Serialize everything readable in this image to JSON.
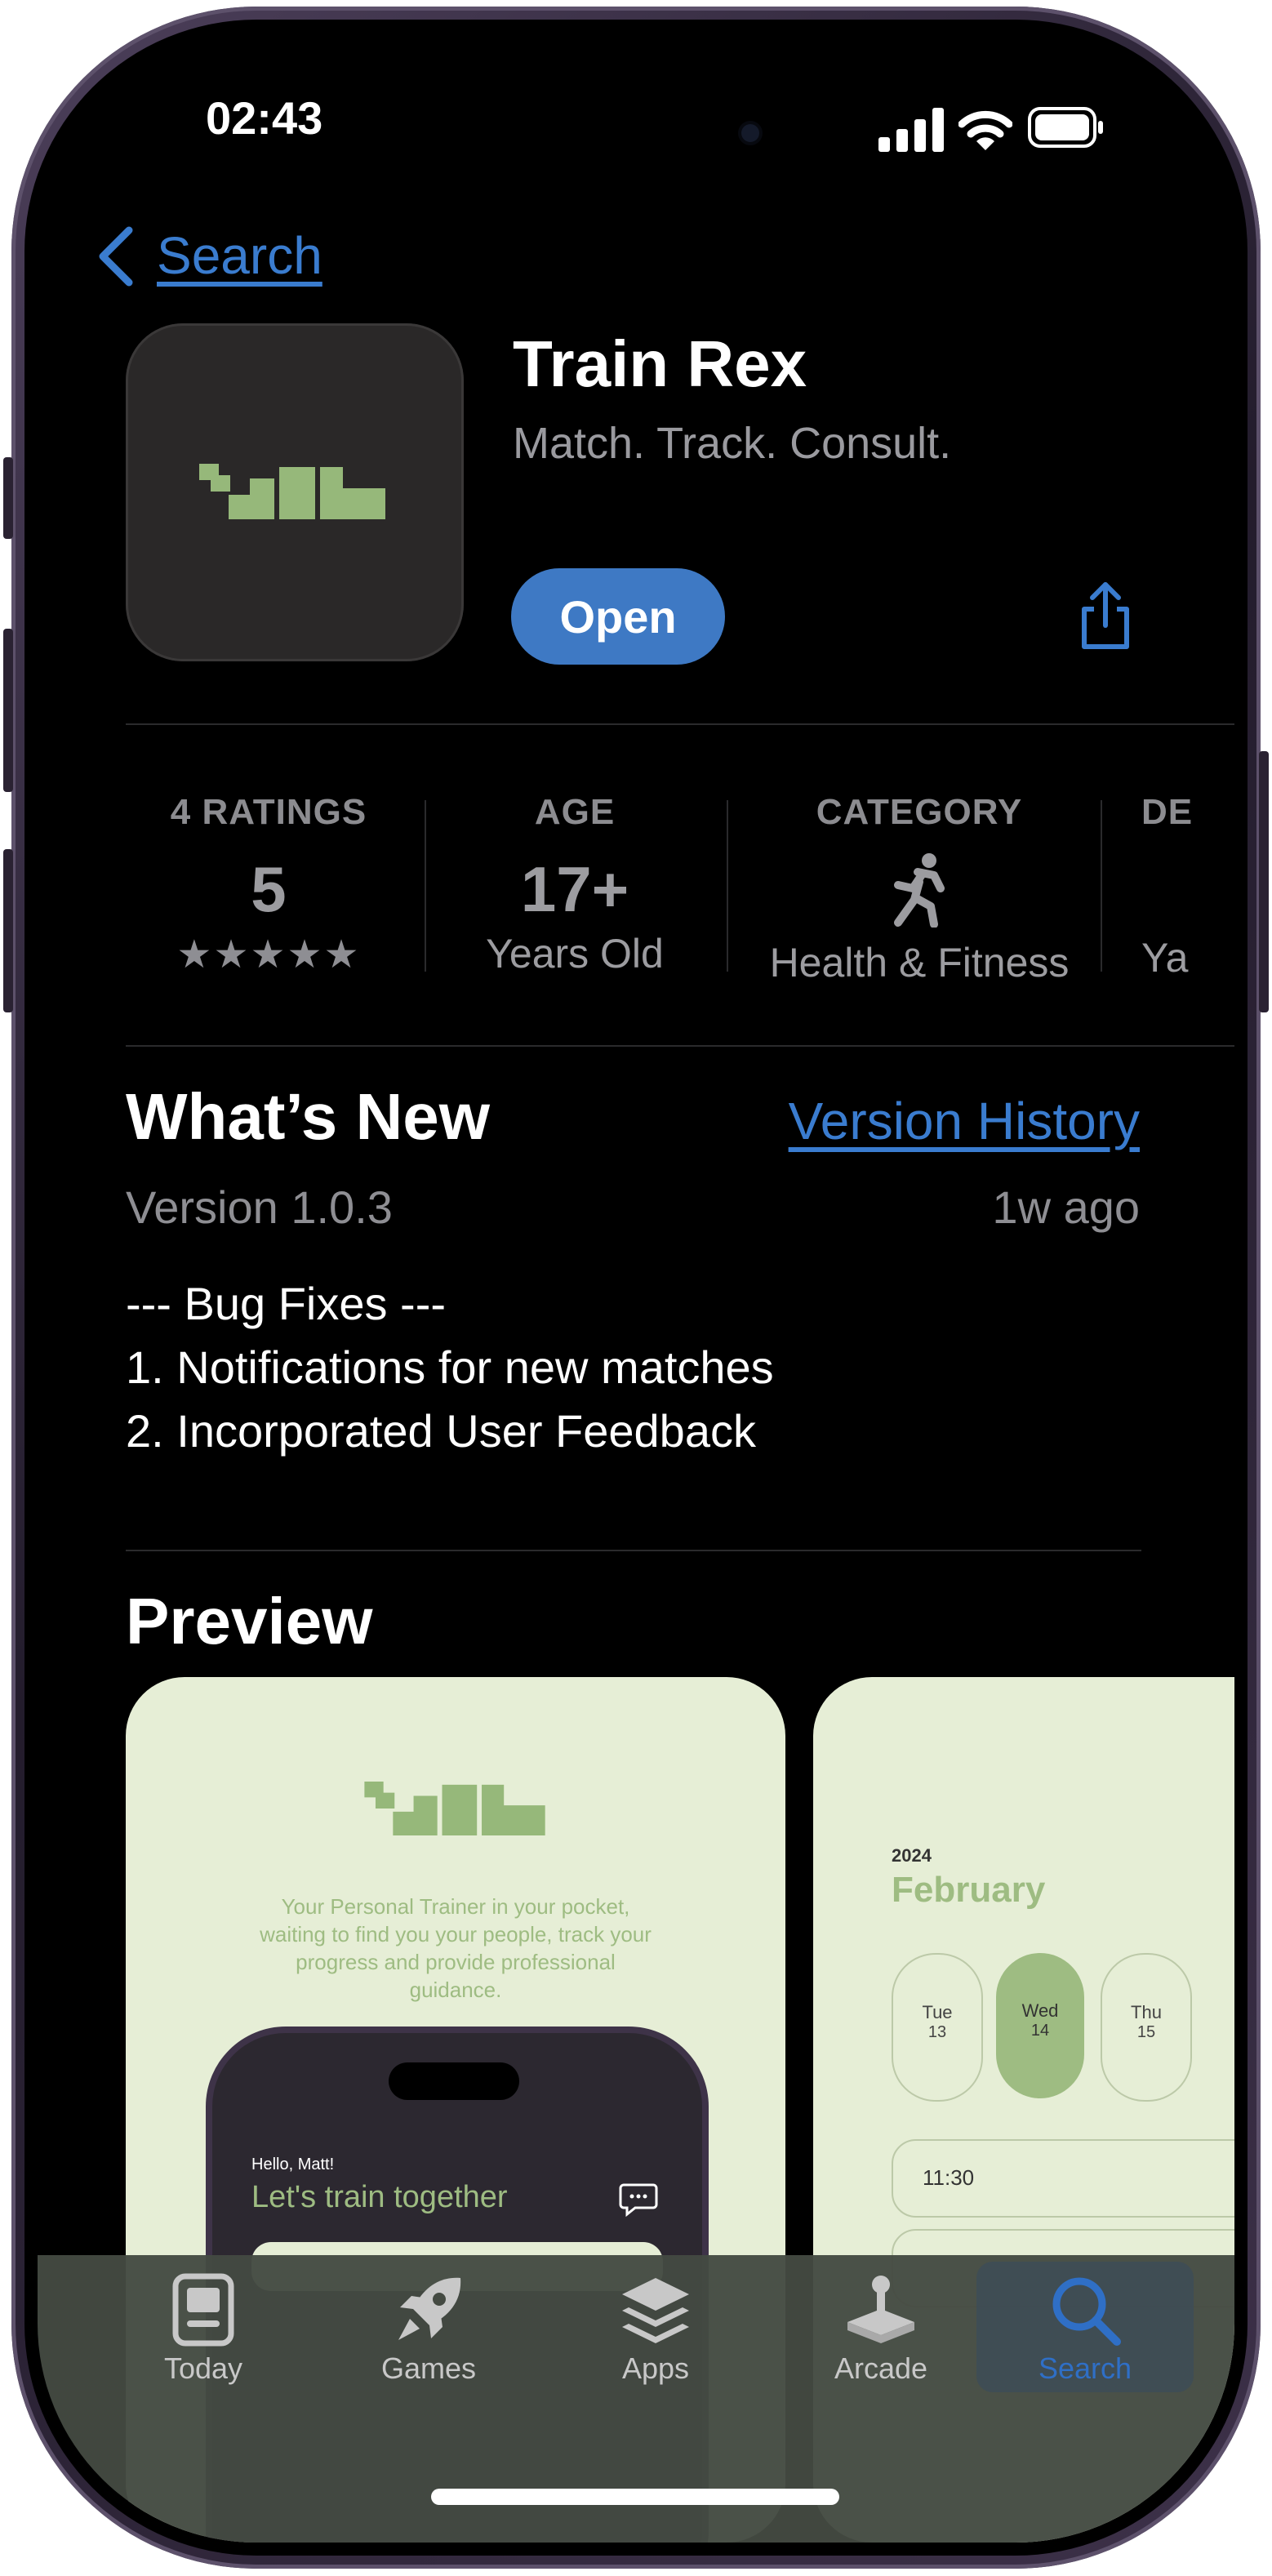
{
  "status_bar": {
    "time": "02:43"
  },
  "nav": {
    "back_label": "Search"
  },
  "app": {
    "name": "Train Rex",
    "subtitle": "Match. Track. Consult.",
    "open_label": "Open"
  },
  "info_strip": [
    {
      "label": "4 RATINGS",
      "value": "5",
      "stars": "★★★★★"
    },
    {
      "label": "AGE",
      "value": "17+",
      "sub": "Years Old"
    },
    {
      "label": "CATEGORY",
      "icon": "runner-icon",
      "sub": "Health & Fitness"
    },
    {
      "label": "DE",
      "sub": "Ya"
    }
  ],
  "whats_new": {
    "title": "What’s New",
    "history_link": "Version History",
    "version": "Version 1.0.3",
    "age": "1w ago",
    "notes": [
      "--- Bug Fixes ---",
      "1. Notifications for new matches",
      "2. Incorporated User Feedback"
    ]
  },
  "preview": {
    "title": "Preview",
    "card1": {
      "tagline_lines": [
        "Your Personal Trainer in your pocket,",
        "waiting to find you your people, track your",
        "progress and provide professional",
        "guidance."
      ],
      "greeting": "Hello, Matt!",
      "headline": "Let's train together"
    },
    "card2": {
      "year": "2024",
      "month": "February",
      "days": [
        {
          "day": "Tue",
          "date": "13"
        },
        {
          "day": "Wed",
          "date": "14"
        },
        {
          "day": "Thu",
          "date": "15"
        }
      ],
      "slot": "11:30"
    }
  },
  "tab_bar": [
    {
      "label": "Today",
      "icon": "today-icon"
    },
    {
      "label": "Games",
      "icon": "rocket-icon"
    },
    {
      "label": "Apps",
      "icon": "layers-icon"
    },
    {
      "label": "Arcade",
      "icon": "joystick-icon"
    },
    {
      "label": "Search",
      "icon": "search-icon",
      "active": true
    }
  ],
  "colors": {
    "accent": "#3e79c4",
    "brand_green": "#96b87a",
    "preview_bg": "#e6eed6"
  }
}
